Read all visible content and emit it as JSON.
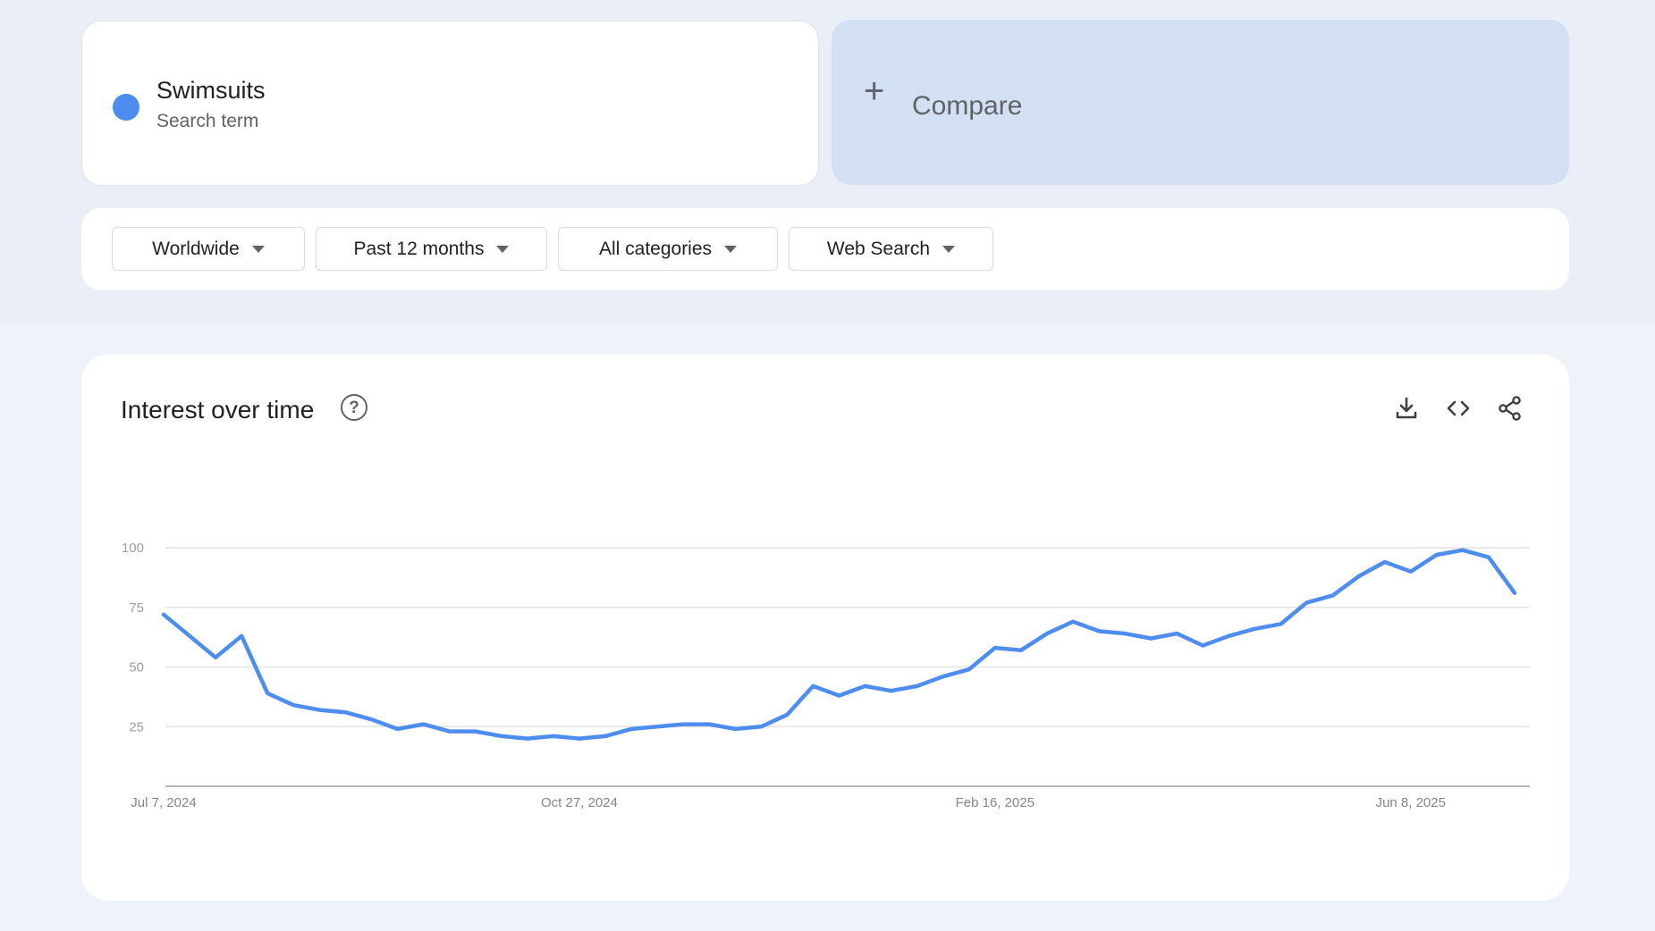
{
  "term": {
    "name": "Swimsuits",
    "type": "Search term",
    "color": "#4e8df0"
  },
  "compare": {
    "label": "Compare",
    "plus": "+"
  },
  "filters": [
    {
      "label": "Worldwide"
    },
    {
      "label": "Past 12 months"
    },
    {
      "label": "All categories"
    },
    {
      "label": "Web Search"
    }
  ],
  "chart": {
    "title": "Interest over time",
    "tools": [
      "download-icon",
      "embed-code-icon",
      "share-icon"
    ]
  },
  "chart_data": {
    "type": "line",
    "title": "Interest over time",
    "xlabel": "",
    "ylabel": "",
    "ylim": [
      0,
      100
    ],
    "yticks": [
      25,
      50,
      75,
      100
    ],
    "grid": true,
    "legend": "none",
    "x_start": "2024-07-07",
    "x_interval_days": 7,
    "x_tick_labels": [
      "Jul 7, 2024",
      "Oct 27, 2024",
      "Feb 16, 2025",
      "Jun 8, 2025"
    ],
    "x_tick_indices": [
      0,
      16,
      32,
      48
    ],
    "series": [
      {
        "name": "Swimsuits",
        "color": "#4e8df0",
        "values": [
          72,
          63,
          54,
          63,
          39,
          34,
          32,
          31,
          28,
          24,
          26,
          23,
          23,
          21,
          20,
          21,
          20,
          21,
          24,
          25,
          26,
          26,
          24,
          25,
          30,
          42,
          38,
          42,
          40,
          42,
          46,
          49,
          58,
          57,
          64,
          69,
          65,
          64,
          62,
          64,
          59,
          63,
          66,
          68,
          77,
          80,
          88,
          94,
          90,
          97,
          99,
          96,
          81
        ]
      }
    ]
  }
}
